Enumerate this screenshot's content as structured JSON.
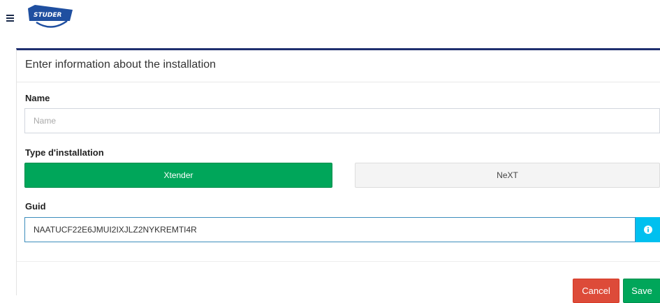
{
  "header": {
    "menu_icon": "hamburger-menu-icon",
    "logo_text": "STUDER",
    "logo_color": "#1f4fa0"
  },
  "form": {
    "title": "Enter information about the installation",
    "name": {
      "label": "Name",
      "placeholder": "Name",
      "value": ""
    },
    "type": {
      "label": "Type d'installation",
      "options": [
        "Xtender",
        "NeXT"
      ],
      "selected": "Xtender"
    },
    "guid": {
      "label": "Guid",
      "value": "NAATUCF22E6JMUI2IXJLZ2NYKREMTI4R",
      "info_icon": "info-icon"
    },
    "actions": {
      "cancel_label": "Cancel",
      "save_label": "Save"
    }
  },
  "colors": {
    "accent_border": "#1f2f6f",
    "success": "#00a65a",
    "danger": "#dd4b39",
    "info": "#00c0ef",
    "focus": "#3c8dbc"
  }
}
